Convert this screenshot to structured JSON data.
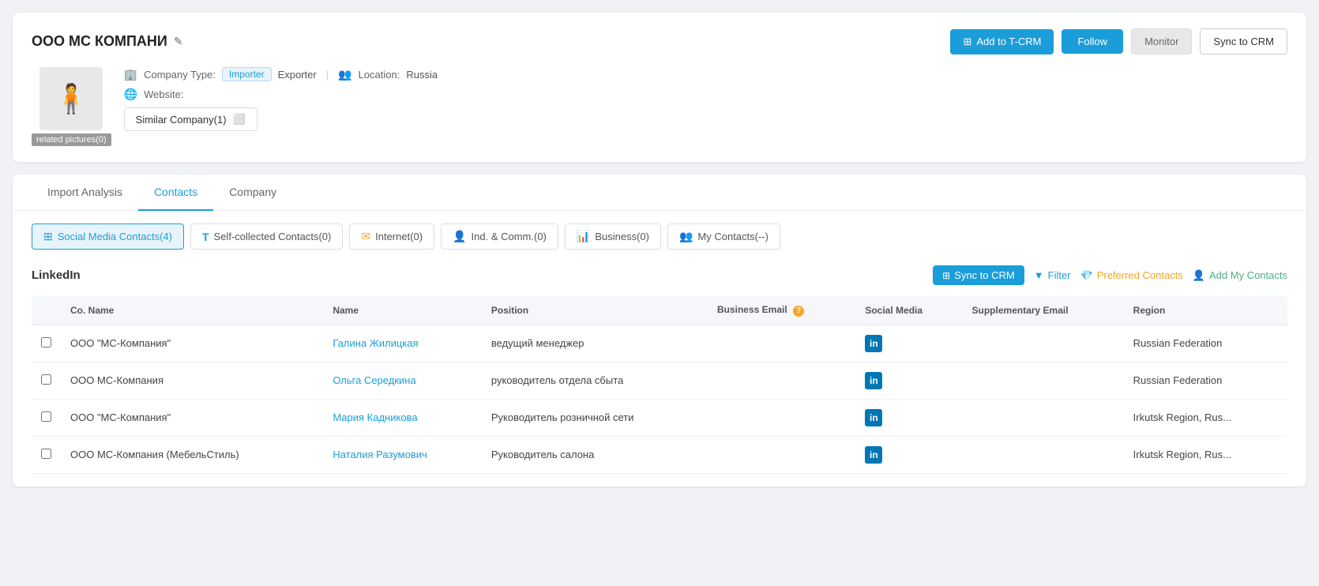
{
  "company": {
    "name": "ООО МС КОМПАНИ",
    "edit_icon": "✎",
    "avatar_label": "related pictures(0)",
    "company_type_label": "Company Type:",
    "type_importer": "Importer",
    "type_exporter": "Exporter",
    "location_label": "Location:",
    "location_value": "Russia",
    "website_label": "Website:",
    "website_value": "",
    "similar_company": "Similar Company(1)"
  },
  "header_buttons": {
    "add_tcrm": "Add to T-CRM",
    "follow": "Follow",
    "monitor": "Monitor",
    "sync_crm": "Sync to CRM"
  },
  "tabs": {
    "items": [
      {
        "label": "Import Analysis",
        "active": false
      },
      {
        "label": "Contacts",
        "active": true
      },
      {
        "label": "Company",
        "active": false
      }
    ]
  },
  "contact_type_tabs": [
    {
      "label": "Social Media Contacts(4)",
      "icon": "⊞",
      "active": true
    },
    {
      "label": "Self-collected Contacts(0)",
      "icon": "T",
      "active": false
    },
    {
      "label": "Internet(0)",
      "icon": "✉",
      "active": false
    },
    {
      "label": "Ind. & Comm.(0)",
      "icon": "👤",
      "active": false
    },
    {
      "label": "Business(0)",
      "icon": "📊",
      "active": false
    },
    {
      "label": "My Contacts(--)",
      "icon": "👥",
      "active": false
    }
  ],
  "linkedin_section": {
    "title": "LinkedIn",
    "actions": {
      "sync": "Sync to CRM",
      "filter": "Filter",
      "preferred": "Preferred Contacts",
      "add": "Add My Contacts"
    }
  },
  "table": {
    "columns": [
      {
        "id": "checkbox",
        "label": ""
      },
      {
        "id": "co_name",
        "label": "Co. Name"
      },
      {
        "id": "name",
        "label": "Name"
      },
      {
        "id": "position",
        "label": "Position"
      },
      {
        "id": "business_email",
        "label": "Business Email"
      },
      {
        "id": "social_media",
        "label": "Social Media"
      },
      {
        "id": "supplementary_email",
        "label": "Supplementary Email"
      },
      {
        "id": "region",
        "label": "Region"
      }
    ],
    "rows": [
      {
        "co_name": "ООО \"МС-Компания\"",
        "name": "Галина Жилицкая",
        "position": "ведущий менеджер",
        "business_email": "",
        "social_media": "in",
        "supplementary_email": "",
        "region": "Russian Federation"
      },
      {
        "co_name": "ООО МС-Компания",
        "name": "Ольга Середкина",
        "position": "руководитель отдела сбыта",
        "business_email": "",
        "social_media": "in",
        "supplementary_email": "",
        "region": "Russian Federation"
      },
      {
        "co_name": "ООО \"МС-Компания\"",
        "name": "Мария Кадникова",
        "position": "Руководитель розничной сети",
        "business_email": "",
        "social_media": "in",
        "supplementary_email": "",
        "region": "Irkutsk Region, Rus..."
      },
      {
        "co_name": "ООО МС-Компания (МебельСтиль)",
        "name": "Наталия Разумович",
        "position": "Руководитель салона",
        "business_email": "",
        "social_media": "in",
        "supplementary_email": "",
        "region": "Irkutsk Region, Rus..."
      }
    ]
  }
}
